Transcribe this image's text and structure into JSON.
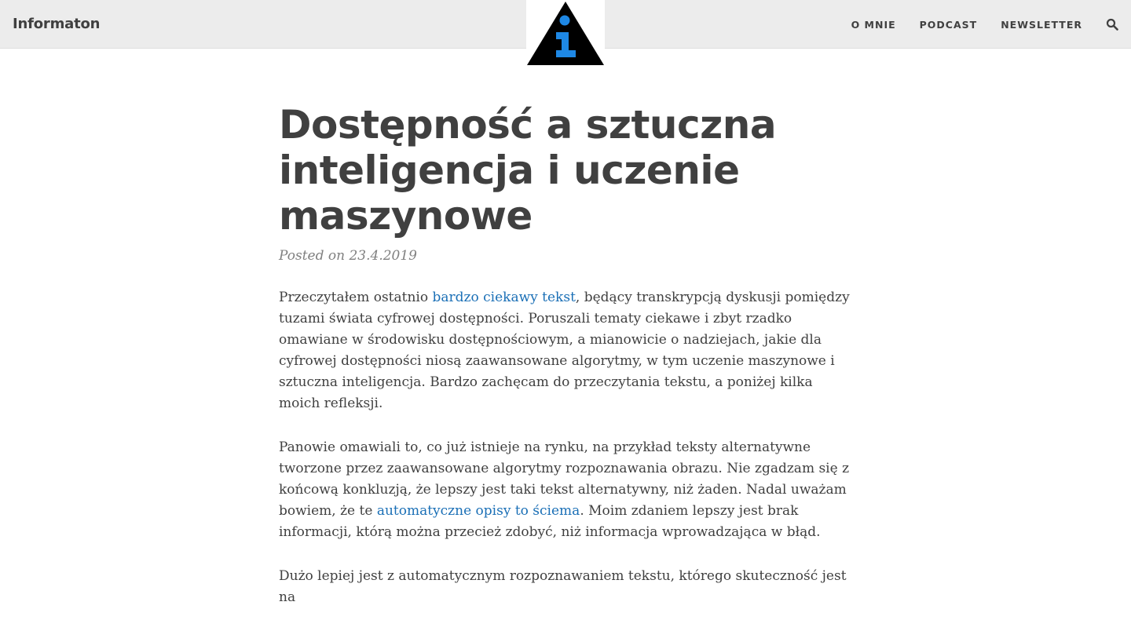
{
  "site": {
    "brand": "Informaton",
    "logo_icon": "info-triangle-icon",
    "colors": {
      "navbar_bg": "#ececec",
      "text": "#404040",
      "link": "#1a6fb6",
      "logo_accent": "#1e88e5"
    }
  },
  "nav": {
    "items": [
      {
        "label": "O MNIE"
      },
      {
        "label": "PODCAST"
      },
      {
        "label": "NEWSLETTER"
      }
    ],
    "search_icon": "search-icon"
  },
  "post": {
    "title": "Dostępność a sztuczna inteligencja i uczenie maszynowe",
    "meta": "Posted on 23.4.2019",
    "p1": {
      "before": "Przeczytałem ostatnio ",
      "link": "bardzo ciekawy tekst",
      "after": ", będący transkrypcją dyskusji pomiędzy tuzami świata cyfrowej dostępności. Poruszali tematy ciekawe i zbyt rzadko omawiane w środowisku dostępnościowym, a mianowicie o nadziejach, jakie dla cyfrowej dostępności niosą zaawansowane algorytmy, w tym uczenie maszynowe i sztuczna inteligencja. Bardzo zachęcam do przeczytania tekstu, a poniżej kilka moich refleksji."
    },
    "p2": {
      "before": "Panowie omawiali to, co już istnieje na rynku, na przykład teksty alternatywne tworzone przez zaawansowane algorytmy rozpoznawania obrazu. Nie zgadzam się z końcową konkluzją, że lepszy jest taki tekst alternatywny, niż żaden. Nadal uważam bowiem, że te ",
      "link": "automatyczne opisy to ściema",
      "after": ". Moim zdaniem lepszy jest brak informacji, którą można przecież zdobyć, niż informacja wprowadzająca w błąd."
    },
    "p3": {
      "text": "Dużo lepiej jest z automatycznym rozpoznawaniem tekstu, którego skuteczność jest na"
    }
  }
}
